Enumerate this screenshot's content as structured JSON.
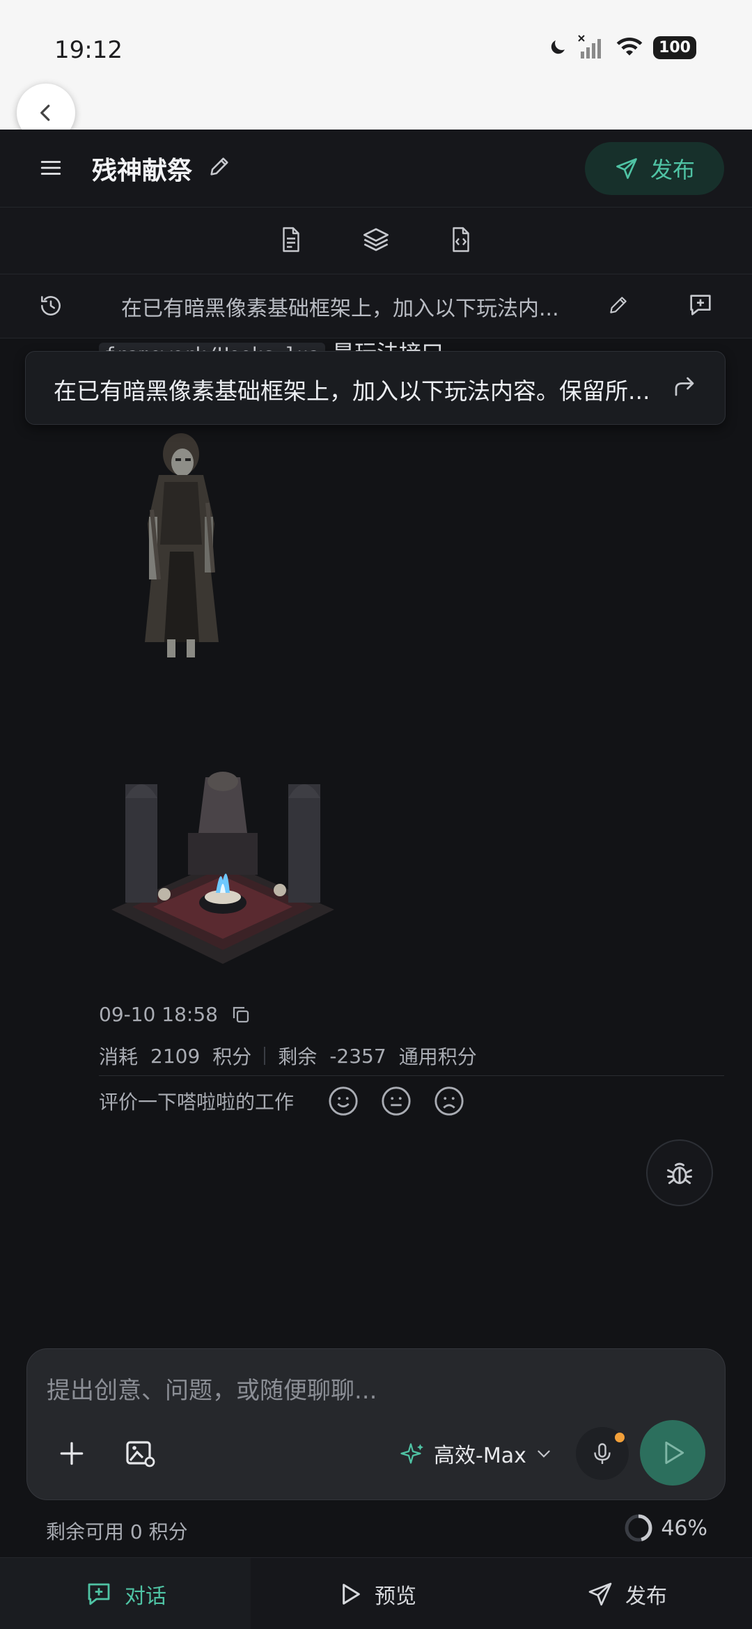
{
  "status_bar": {
    "time": "19:12",
    "battery": "100"
  },
  "header": {
    "title": "残神献祭",
    "publish_label": "发布"
  },
  "prompt_bar": {
    "text": "在已有暗黑像素基础框架上，加入以下玩法内..."
  },
  "chat": {
    "code_snippet": "framework/Hooks.lua",
    "code_suffix": " 是玩法接口",
    "floating_prompt": "在已有暗黑像素基础框架上，加入以下玩法内容。保留所...",
    "timestamp": "09-10 18:58",
    "cost_label": "消耗",
    "cost_value": "2109",
    "cost_unit": "积分",
    "remain_label": "剩余",
    "remain_value": "-2357",
    "remain_unit": "通用积分",
    "rate_prompt": "评价一下嗒啦啦的工作"
  },
  "composer": {
    "placeholder": "提出创意、问题，或随便聊聊...",
    "model": "高效-Max"
  },
  "footer": {
    "remaining": "剩余可用 0 积分",
    "progress_label": "46%",
    "progress_value": 0.46
  },
  "tabs": [
    {
      "label": "对话",
      "icon": "chat-plus-icon",
      "active": true
    },
    {
      "label": "预览",
      "icon": "play-icon",
      "active": false
    },
    {
      "label": "发布",
      "icon": "send-icon",
      "active": false
    }
  ],
  "colors": {
    "accent": "#4fc3a4",
    "background": "#121316",
    "surface": "#16171b"
  }
}
